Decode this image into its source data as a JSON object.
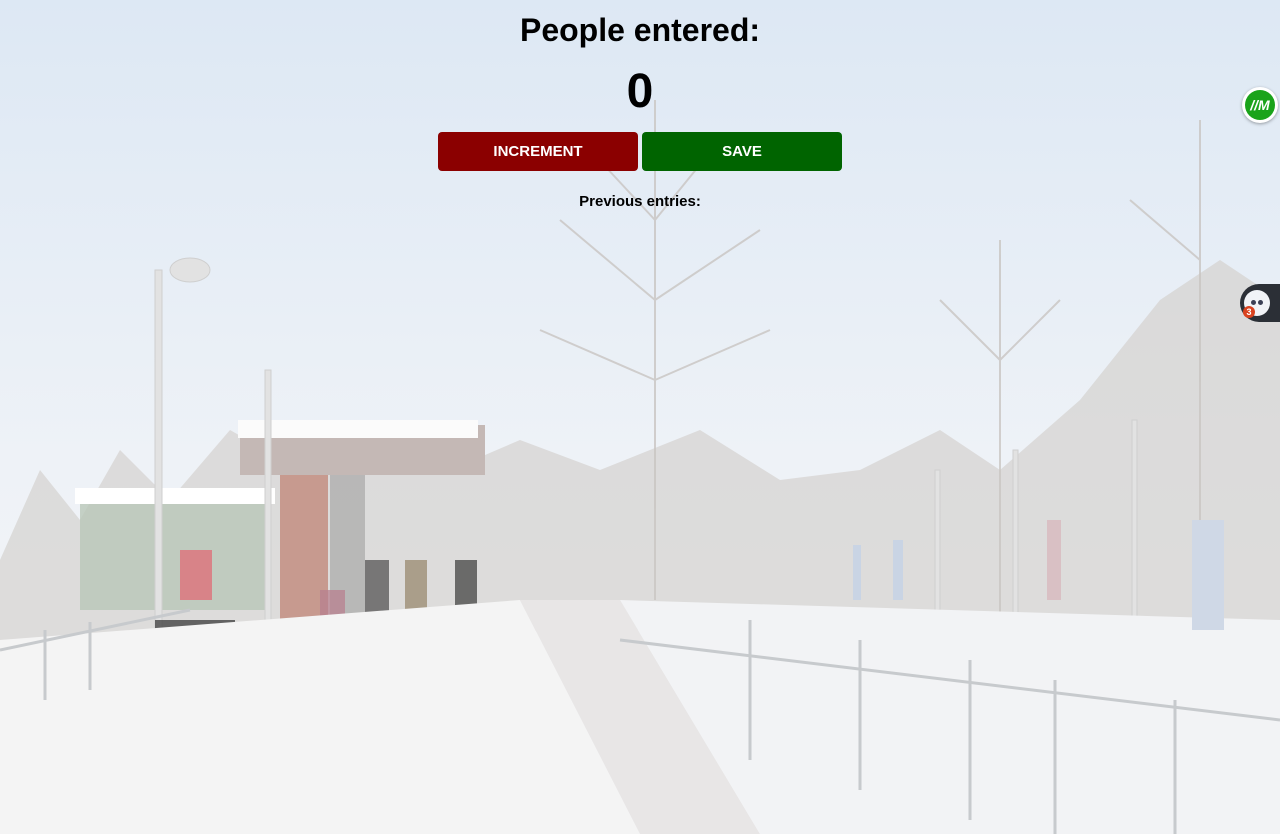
{
  "counter": {
    "title": "People entered:",
    "count": "0",
    "increment_label": "INCREMENT",
    "save_label": "SAVE",
    "previous_label": "Previous entries:"
  },
  "extensions": {
    "badge_icon": "im-extension-icon",
    "tab_icon": "face-extension-icon",
    "tab_count": "3"
  },
  "colors": {
    "increment": "#8b0000",
    "save": "#006400",
    "extension_green": "#1aa31a"
  }
}
